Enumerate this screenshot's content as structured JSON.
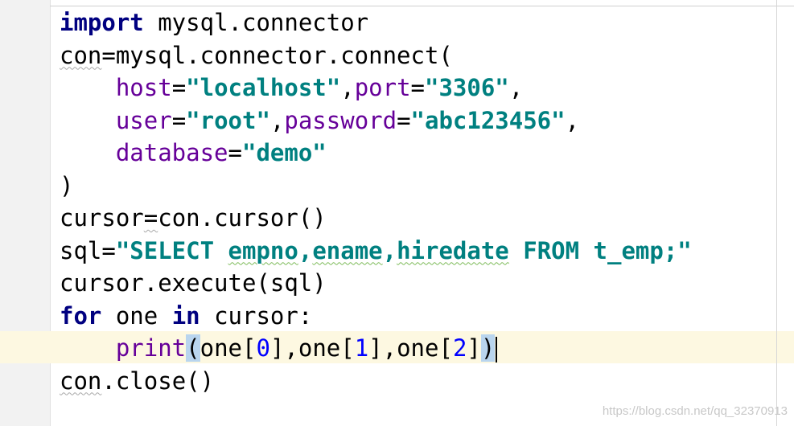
{
  "editor": {
    "lines": [
      {
        "t1": "import",
        "t2": " mysql.connector"
      },
      {
        "t1": "con",
        "t2": "=mysql.connector.connect("
      },
      {
        "indent": "    ",
        "k1": "host",
        "eq1": "=",
        "s1": "\"localhost\"",
        "c1": ",",
        "k2": "port",
        "eq2": "=",
        "s2": "\"3306\"",
        "c2": ","
      },
      {
        "indent": "    ",
        "k1": "user",
        "eq1": "=",
        "s1": "\"root\"",
        "c1": ",",
        "k2": "password",
        "eq2": "=",
        "s2": "\"abc123456\"",
        "c2": ","
      },
      {
        "indent": "    ",
        "k1": "database",
        "eq1": "=",
        "s1": "\"demo\""
      },
      {
        "t1": ")"
      },
      {
        "a": "cursor",
        "b": "=",
        "c": "con.cursor()"
      },
      {
        "a": "sql=",
        "s1": "\"SELECT ",
        "w1": "empno",
        "c1": ",",
        "w2": "ename",
        "c2": ",",
        "w3": "hiredate",
        "s2": " FROM t_emp;\""
      },
      {
        "t1": "cursor.execute(sql)"
      },
      {
        "k1": "for",
        "m": " one ",
        "k2": "in",
        "e": " cursor:"
      },
      {
        "indent": "    ",
        "p": "print",
        "po": "(",
        "a1": "one[",
        "n0": "0",
        "a2": "],one[",
        "n1": "1",
        "a3": "],one[",
        "n2": "2",
        "a4": "]",
        "pc": ")"
      },
      {
        "w": "con",
        "e": ".close()"
      }
    ]
  },
  "watermark": "https://blog.csdn.net/qq_32370913"
}
